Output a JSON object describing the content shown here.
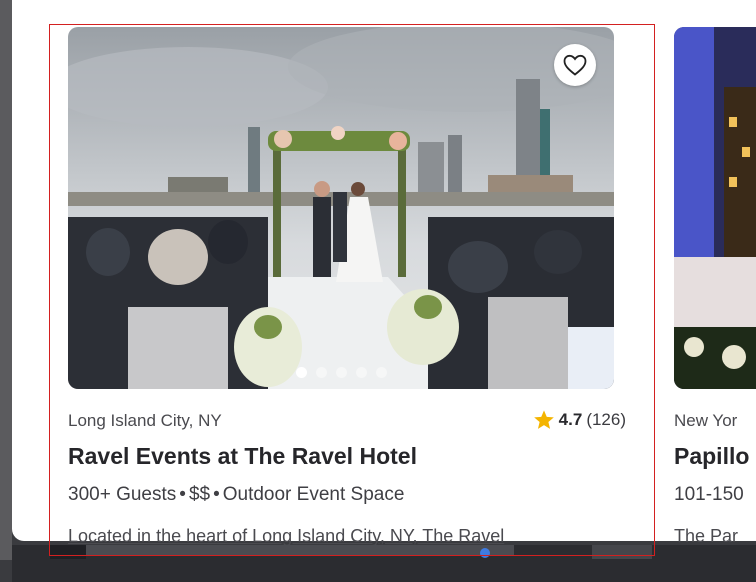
{
  "card": {
    "location": "Long Island City, NY",
    "rating": {
      "score": "4.7",
      "count": "(126)"
    },
    "title": "Ravel Events at The Ravel Hotel",
    "meta": {
      "guests": "300+ Guests",
      "price": "$$",
      "type": "Outdoor Event Space",
      "separator": "•"
    },
    "description": "Located in the heart of Long Island City, NY, The Ravel",
    "carousel": {
      "total": 5,
      "active": 1
    },
    "favorite_icon": "heart-outline-icon",
    "star_icon": "star-icon",
    "star_color": "#f4b400"
  },
  "card2": {
    "location": "New Yor",
    "title": "Papillo",
    "meta": "101-150",
    "description": "The Par"
  }
}
